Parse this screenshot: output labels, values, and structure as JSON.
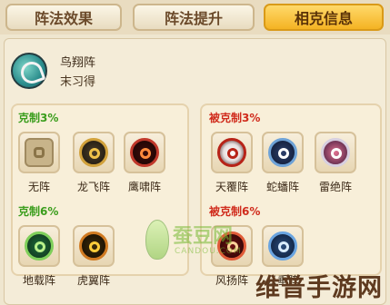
{
  "tabs": [
    {
      "label": "阵法效果",
      "active": false
    },
    {
      "label": "阵法提升",
      "active": false
    },
    {
      "label": "相克信息",
      "active": true
    }
  ],
  "formation": {
    "name": "鸟翔阵",
    "status": "末习得",
    "icon": "bird-formation-icon"
  },
  "left": {
    "section1": {
      "title": "克制3%",
      "items": [
        {
          "label": "无阵",
          "icon": "lock-icon"
        },
        {
          "label": "龙飞阵",
          "icon": "dragon-formation-icon"
        },
        {
          "label": "鹰啸阵",
          "icon": "eagle-formation-icon"
        }
      ]
    },
    "section2": {
      "title": "克制6%",
      "items": [
        {
          "label": "地载阵",
          "icon": "earth-formation-icon"
        },
        {
          "label": "虎翼阵",
          "icon": "tiger-formation-icon"
        }
      ]
    }
  },
  "right": {
    "section1": {
      "title": "被克制3%",
      "items": [
        {
          "label": "天覆阵",
          "icon": "heaven-formation-icon"
        },
        {
          "label": "蛇蟠阵",
          "icon": "snake-formation-icon"
        },
        {
          "label": "雷绝阵",
          "icon": "thunder-formation-icon"
        }
      ]
    },
    "section2": {
      "title": "被克制6%",
      "items": [
        {
          "label": "风扬阵",
          "icon": "wind-formation-icon"
        },
        {
          "label": "云垂阵",
          "icon": "cloud-formation-icon"
        }
      ]
    }
  },
  "watermark": {
    "text": "蚕豆网",
    "sub": "CANDOU.COM"
  },
  "brand": "维普手游网",
  "colors": {
    "accent": "#f4b323",
    "green": "#3a9d1c",
    "red": "#d02b1c"
  }
}
